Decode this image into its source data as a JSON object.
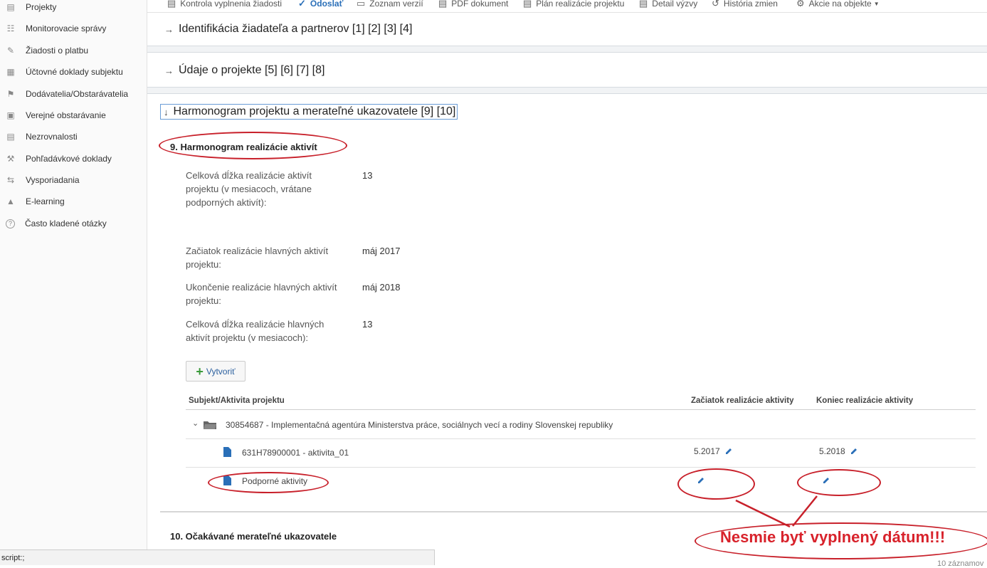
{
  "sidebar": {
    "items": [
      {
        "label": "Projekty",
        "icon": "projects-icon"
      },
      {
        "label": "Monitorovacie správy",
        "icon": "clipboard-icon"
      },
      {
        "label": "Žiadosti o platbu",
        "icon": "payment-icon"
      },
      {
        "label": "Účtovné doklady subjektu",
        "icon": "ledger-icon"
      },
      {
        "label": "Dodávatelia/Obstarávatelia",
        "icon": "supplier-icon"
      },
      {
        "label": "Verejné obstarávanie",
        "icon": "briefcase-icon"
      },
      {
        "label": "Nezrovnalosti",
        "icon": "irregularity-icon"
      },
      {
        "label": "Pohľadávkové doklady",
        "icon": "gavel-icon"
      },
      {
        "label": "Vysporiadania",
        "icon": "exchange-icon"
      },
      {
        "label": "E-learning",
        "icon": "graduation-cap-icon"
      },
      {
        "label": "Často kladené otázky",
        "icon": "question-icon"
      }
    ]
  },
  "toolbar": {
    "items": [
      {
        "label": "Kontrola vyplnenia žiadosti",
        "icon": "check-document-icon"
      },
      {
        "label": "Odoslať",
        "icon": "check-circle-icon"
      },
      {
        "label": "Zoznam verzií",
        "icon": "versions-icon"
      },
      {
        "label": "PDF dokument",
        "icon": "pdf-icon"
      },
      {
        "label": "Plán realizácie projektu",
        "icon": "plan-icon"
      },
      {
        "label": "Detail výzvy",
        "icon": "detail-icon"
      },
      {
        "label": "História zmien",
        "icon": "history-icon"
      },
      {
        "label": "Akcie na objekte",
        "icon": "gear-icon"
      }
    ]
  },
  "sections": {
    "identification": "Identifikácia žiadateľa a partnerov [1] [2] [3] [4]",
    "project_data": "Údaje o projekte [5] [6] [7] [8]",
    "harmonogram": "Harmonogram projektu a merateľné ukazovatele [9] [10]"
  },
  "harmonogram": {
    "heading": "9. Harmonogram realizácie aktivít",
    "fields": [
      {
        "label": "Celková dĺžka realizácie aktivít projektu (v mesiacoch, vrátane podporných aktivít):",
        "value": "13"
      },
      {
        "label": "Začiatok realizácie hlavných aktivít projektu:",
        "value": "máj 2017"
      },
      {
        "label": "Ukončenie realizácie hlavných aktivít projektu:",
        "value": "máj 2018"
      },
      {
        "label": "Celková dĺžka realizácie hlavných aktivít projektu (v mesiacoch):",
        "value": "13"
      }
    ],
    "create_button": "Vytvoriť",
    "table": {
      "columns": [
        "Subjekt/Aktivita projektu",
        "Začiatok realizácie aktivity",
        "Koniec realizácie aktivity"
      ],
      "group": "30854687 - Implementačná agentúra Ministerstva práce, sociálnych vecí a rodiny Slovenskej republiky",
      "rows": [
        {
          "name": "631H78900001 - aktivita_01",
          "start": "5.2017",
          "end": "5.2018"
        },
        {
          "name": "Podporné aktivity",
          "start": "",
          "end": ""
        }
      ]
    }
  },
  "indicators_heading": "10. Očakávané merateľné ukazovatele",
  "annotation": "Nesmie byť vyplnený dátum!!!",
  "status_bar": "script:;",
  "records": "10 záznamov",
  "colors": {
    "accent": "#2a6fb8",
    "annotation": "#d8222b"
  }
}
